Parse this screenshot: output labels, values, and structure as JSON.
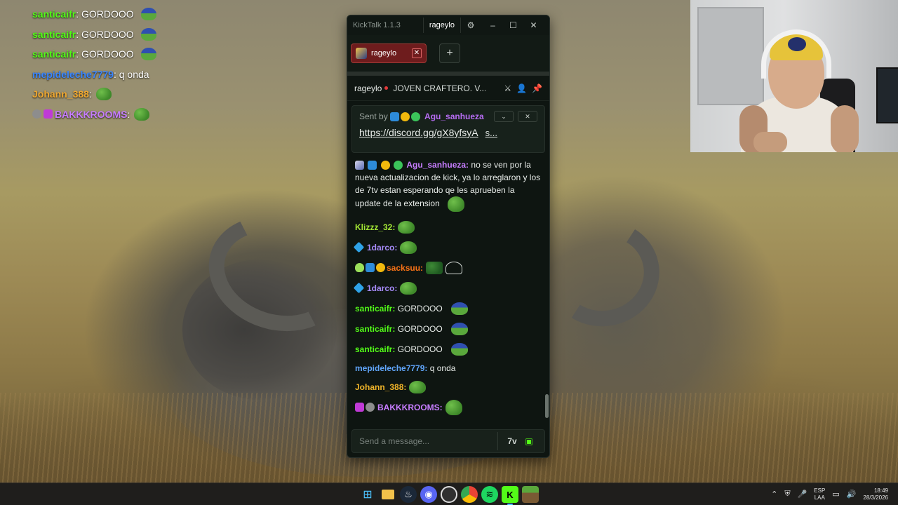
{
  "overlay_chat": [
    {
      "user": "santicaifr",
      "color": "#53fc18",
      "text": "GORDOOO",
      "emote": "pepe-hat-emote"
    },
    {
      "user": "santicaifr",
      "color": "#53fc18",
      "text": "GORDOOO",
      "emote": "pepe-hat-emote"
    },
    {
      "user": "santicaifr",
      "color": "#53fc18",
      "text": "GORDOOO",
      "emote": "pepe-hat-emote"
    },
    {
      "user": "mepideleche7779",
      "color": "#3a86ff",
      "text": "q onda",
      "emote": ""
    },
    {
      "user": "Johann_388",
      "color": "#f0a830",
      "text": "",
      "emote": "pepe-emote"
    },
    {
      "user": "BAKKKROOMS",
      "color": "#c77dff",
      "text": "",
      "emote": "pepe-emote"
    }
  ],
  "kicktalk": {
    "app_title": "KickTalk 1.1.3",
    "title_tab": "rageylo",
    "tab_label": "rageylo",
    "stream": {
      "channel": "rageylo",
      "title": "JOVEN CRAFTERO. V..."
    },
    "pinned": {
      "sent_by_label": "Sent by",
      "user": "Agu_sanhueza",
      "link": "https://discord.gg/gX8yfsyA",
      "more": "s..."
    },
    "messages": [
      {
        "user": "Agu_sanhueza:",
        "color": "#c77dff",
        "text": "no se ven por la nueva actualizacion de kick, ya lo arreglaron y los de 7tv estan esperando qe les aprueben la update de la extension"
      },
      {
        "user": "Klizzz_32:",
        "color": "#a3e635",
        "text": ""
      },
      {
        "user": "1darco:",
        "color": "#a78bfa",
        "text": ""
      },
      {
        "user": "sacksuu:",
        "color": "#f97316",
        "text": ""
      },
      {
        "user": "1darco:",
        "color": "#a78bfa",
        "text": ""
      },
      {
        "user": "santicaifr:",
        "color": "#53fc18",
        "text": "GORDOOO"
      },
      {
        "user": "santicaifr:",
        "color": "#53fc18",
        "text": "GORDOOO"
      },
      {
        "user": "santicaifr:",
        "color": "#53fc18",
        "text": "GORDOOO"
      },
      {
        "user": "mepideleche7779:",
        "color": "#60a5fa",
        "text": "q onda"
      },
      {
        "user": "Johann_388:",
        "color": "#f0b429",
        "text": ""
      },
      {
        "user": "BAKKKROOMS:",
        "color": "#c77dff",
        "text": ""
      }
    ],
    "input_placeholder": "Send a message...",
    "seventv_label": "7v",
    "accent": "#53fc18"
  },
  "taskbar": {
    "lang_top": "ESP",
    "lang_bottom": "LAA",
    "time": "18:49",
    "date": "28/3/2026"
  }
}
